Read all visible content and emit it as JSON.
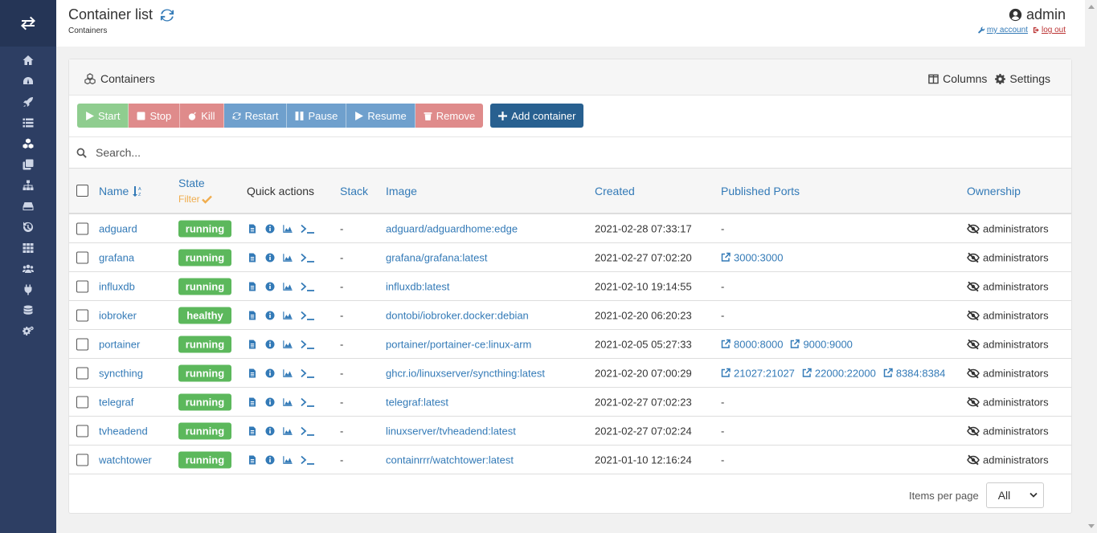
{
  "header": {
    "title": "Container list",
    "breadcrumb": "Containers",
    "username": "admin",
    "my_account": "my account",
    "log_out": "log out"
  },
  "sidebar": {
    "items": [
      {
        "name": "home-icon"
      },
      {
        "name": "dashboard-icon"
      },
      {
        "name": "rocket-icon"
      },
      {
        "name": "list-icon"
      },
      {
        "name": "cubes-icon",
        "active": true
      },
      {
        "name": "clone-icon"
      },
      {
        "name": "sitemap-icon"
      },
      {
        "name": "hdd-icon"
      },
      {
        "name": "history-icon"
      },
      {
        "name": "th-icon"
      },
      {
        "name": "users-icon"
      },
      {
        "name": "plug-icon"
      },
      {
        "name": "database-icon"
      },
      {
        "name": "cogs-icon"
      }
    ]
  },
  "panel": {
    "title": "Containers",
    "columns_label": "Columns",
    "settings_label": "Settings"
  },
  "actions": {
    "start": "Start",
    "stop": "Stop",
    "kill": "Kill",
    "restart": "Restart",
    "pause": "Pause",
    "resume": "Resume",
    "remove": "Remove",
    "add": "Add container"
  },
  "search": {
    "placeholder": "Search..."
  },
  "table": {
    "headers": {
      "name": "Name",
      "state": "State",
      "filter": "Filter",
      "quick_actions": "Quick actions",
      "stack": "Stack",
      "image": "Image",
      "created": "Created",
      "ports": "Published Ports",
      "ownership": "Ownership"
    },
    "rows": [
      {
        "name": "adguard",
        "state": "running",
        "stack": "-",
        "image": "adguard/adguardhome:edge",
        "created": "2021-02-28 07:33:17",
        "ports": [],
        "ownership": "administrators"
      },
      {
        "name": "grafana",
        "state": "running",
        "stack": "-",
        "image": "grafana/grafana:latest",
        "created": "2021-02-27 07:02:20",
        "ports": [
          "3000:3000"
        ],
        "ownership": "administrators"
      },
      {
        "name": "influxdb",
        "state": "running",
        "stack": "-",
        "image": "influxdb:latest",
        "created": "2021-02-10 19:14:55",
        "ports": [],
        "ownership": "administrators"
      },
      {
        "name": "iobroker",
        "state": "healthy",
        "stack": "-",
        "image": "dontobi/iobroker.docker:debian",
        "created": "2021-02-20 06:20:23",
        "ports": [],
        "ownership": "administrators"
      },
      {
        "name": "portainer",
        "state": "running",
        "stack": "-",
        "image": "portainer/portainer-ce:linux-arm",
        "created": "2021-02-05 05:27:33",
        "ports": [
          "8000:8000",
          "9000:9000"
        ],
        "ownership": "administrators"
      },
      {
        "name": "syncthing",
        "state": "running",
        "stack": "-",
        "image": "ghcr.io/linuxserver/syncthing:latest",
        "created": "2021-02-20 07:00:29",
        "ports": [
          "21027:21027",
          "22000:22000",
          "8384:8384"
        ],
        "ownership": "administrators"
      },
      {
        "name": "telegraf",
        "state": "running",
        "stack": "-",
        "image": "telegraf:latest",
        "created": "2021-02-27 07:02:23",
        "ports": [],
        "ownership": "administrators"
      },
      {
        "name": "tvheadend",
        "state": "running",
        "stack": "-",
        "image": "linuxserver/tvheadend:latest",
        "created": "2021-02-27 07:02:24",
        "ports": [],
        "ownership": "administrators"
      },
      {
        "name": "watchtower",
        "state": "running",
        "stack": "-",
        "image": "containrrr/watchtower:latest",
        "created": "2021-01-10 12:16:24",
        "ports": [],
        "ownership": "administrators"
      }
    ],
    "no_ports": "-"
  },
  "footer": {
    "items_per_page": "Items per page",
    "selected": "All"
  },
  "colors": {
    "sidebar": "#2d3e63",
    "link": "#337ab7",
    "running": "#5cb85c",
    "filter": "#f0ad4e",
    "add_button": "#286090"
  }
}
